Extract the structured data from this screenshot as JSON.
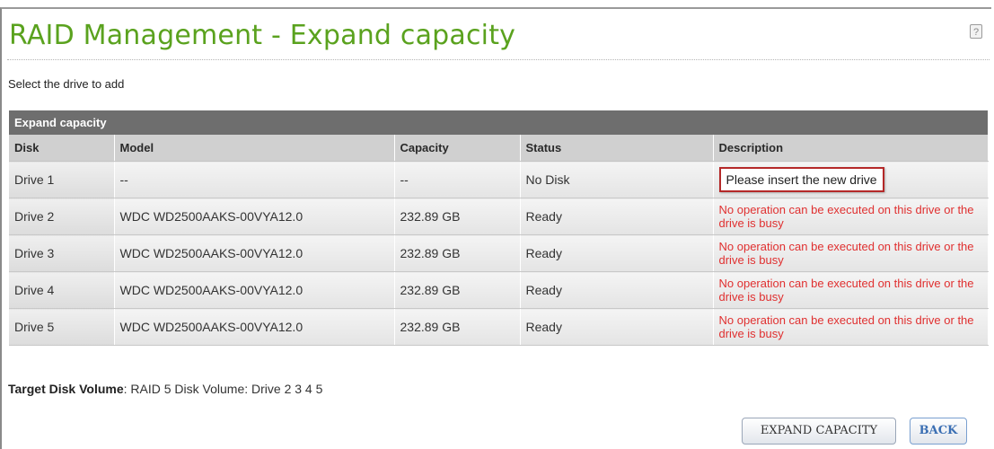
{
  "page": {
    "title": "RAID Management - Expand capacity",
    "help_icon": "help-icon",
    "instruction": "Select the drive to add"
  },
  "table": {
    "caption": "Expand capacity",
    "columns": [
      "Disk",
      "Model",
      "Capacity",
      "Status",
      "Description"
    ],
    "rows": [
      {
        "disk": "Drive 1",
        "model": "--",
        "capacity": "--",
        "status": "No Disk",
        "description": "Please insert the new drive"
      },
      {
        "disk": "Drive 2",
        "model": "WDC WD2500AAKS-00VYA12.0",
        "capacity": "232.89 GB",
        "status": "Ready",
        "description": "No operation can be executed on this drive or the drive is busy"
      },
      {
        "disk": "Drive 3",
        "model": "WDC WD2500AAKS-00VYA12.0",
        "capacity": "232.89 GB",
        "status": "Ready",
        "description": "No operation can be executed on this drive or the drive is busy"
      },
      {
        "disk": "Drive 4",
        "model": "WDC WD2500AAKS-00VYA12.0",
        "capacity": "232.89 GB",
        "status": "Ready",
        "description": "No operation can be executed on this drive or the drive is busy"
      },
      {
        "disk": "Drive 5",
        "model": "WDC WD2500AAKS-00VYA12.0",
        "capacity": "232.89 GB",
        "status": "Ready",
        "description": "No operation can be executed on this drive or the drive is busy"
      }
    ]
  },
  "target": {
    "label": "Target Disk Volume",
    "value": ": RAID 5 Disk Volume: Drive  2 3 4 5"
  },
  "buttons": {
    "expand": "EXPAND CAPACITY",
    "back": "BACK"
  },
  "colors": {
    "title": "#5aa21e",
    "header_bar": "#6e6e6e",
    "warning_text": "#e03030",
    "highlight_border": "#b42828"
  }
}
